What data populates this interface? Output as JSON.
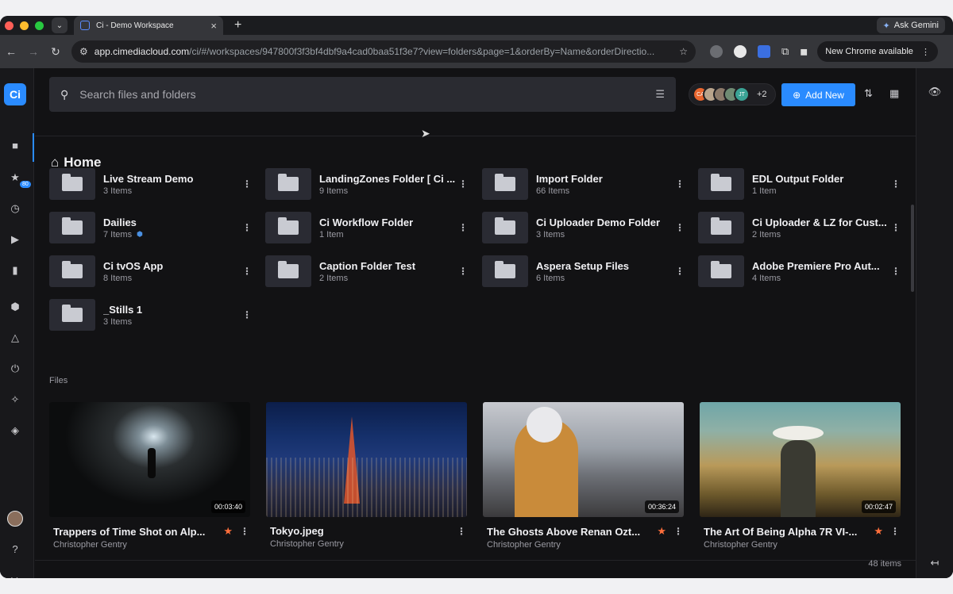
{
  "browser": {
    "tab_title": "Ci - Demo Workspace",
    "url_host": "app.cimediacloud.com",
    "url_path": "/ci/#/workspaces/947800f3f3bf4dbf9a4cad0baa51f3e7?view=folders&page=1&orderBy=Name&orderDirectio...",
    "gemini_label": "Ask Gemini",
    "update_label": "New Chrome available"
  },
  "sidebar": {
    "logo": "Ci",
    "recent_badge": "80"
  },
  "search": {
    "placeholder": "Search files and folders"
  },
  "collaborators": {
    "avatars": [
      {
        "initials": "CA",
        "color": "#e8662f"
      },
      {
        "initials": "",
        "color": "#b9a48c"
      },
      {
        "initials": "",
        "color": "#8c7a6a"
      },
      {
        "initials": "",
        "color": "#6f8b73"
      },
      {
        "initials": "JT",
        "color": "#3aa395"
      }
    ],
    "more": "+2"
  },
  "toolbar": {
    "add_new": "Add New"
  },
  "breadcrumb": {
    "title": "Home"
  },
  "folders": [
    {
      "name": "Live Stream Demo",
      "count": "3 Items"
    },
    {
      "name": "LandingZones Folder [ Ci ...",
      "count": "9 Items"
    },
    {
      "name": "Import Folder",
      "count": "66 Items"
    },
    {
      "name": "EDL Output Folder",
      "count": "1 Item"
    },
    {
      "name": "Dailies",
      "count": "7 Items",
      "shared": true
    },
    {
      "name": "Ci Workflow Folder",
      "count": "1 Item"
    },
    {
      "name": "Ci Uploader Demo Folder",
      "count": "3 Items"
    },
    {
      "name": "Ci Uploader & LZ for Cust...",
      "count": "2 Items"
    },
    {
      "name": "Ci tvOS App",
      "count": "8 Items"
    },
    {
      "name": "Caption Folder Test",
      "count": "2 Items"
    },
    {
      "name": "Aspera Setup Files",
      "count": "6 Items"
    },
    {
      "name": "Adobe Premiere Pro Aut...",
      "count": "4 Items"
    },
    {
      "name": "_Stills 1",
      "count": "3 Items"
    }
  ],
  "files_label": "Files",
  "files": [
    {
      "title": "Trappers of Time Shot on Alp...",
      "author": "Christopher Gentry",
      "duration": "00:03:40",
      "starred": true
    },
    {
      "title": "Tokyo.jpeg",
      "author": "Christopher Gentry",
      "duration": "",
      "starred": false
    },
    {
      "title": "The Ghosts Above Renan Ozt...",
      "author": "Christopher Gentry",
      "duration": "00:36:24",
      "starred": true
    },
    {
      "title": "The Art Of Being Alpha 7R VI-...",
      "author": "Christopher Gentry",
      "duration": "00:02:47",
      "starred": true
    }
  ],
  "footer": {
    "count": "48 items"
  }
}
